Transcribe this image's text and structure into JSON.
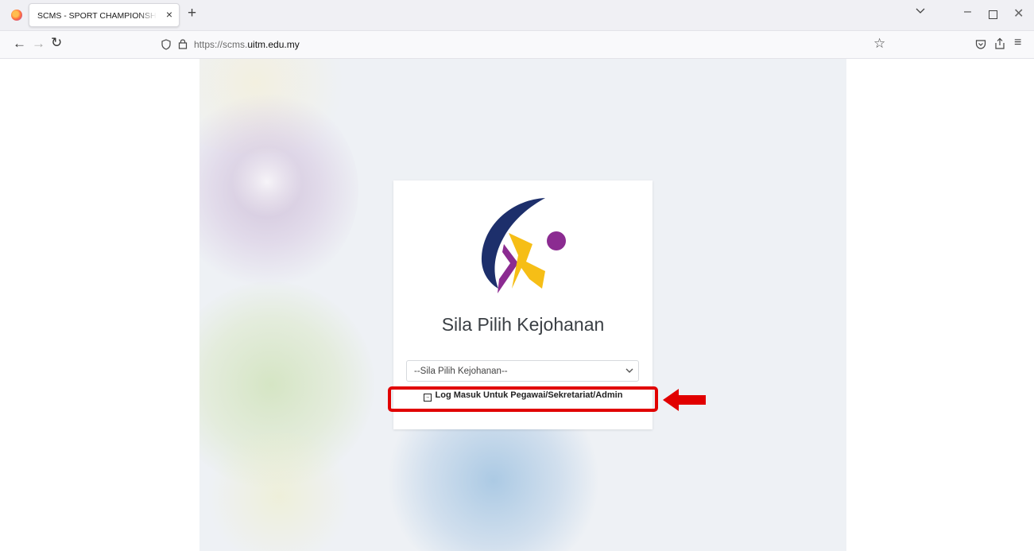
{
  "browser": {
    "tab_title": "SCMS - SPORT CHAMPIONSHIP MANAGEMENT SYSTEM",
    "tab_close": "×",
    "new_tab": "+",
    "url_prefix": "https://scms.",
    "url_domain": "uitm.edu.my",
    "icons": [
      "firefox-icon",
      "back-icon",
      "forward-icon",
      "reload-icon",
      "shield-icon",
      "lock-icon",
      "star-icon",
      "pocket-icon",
      "share-icon",
      "menu-icon"
    ]
  },
  "page": {
    "heading": "Sila Pilih Kejohanan",
    "select_value": "--Sila Pilih Kejohanan--",
    "login_link": "Log Masuk Untuk Pegawai/Sekretariat/Admin",
    "logo_colors": {
      "arc": "#1d2f6b",
      "purple": "#8b2b91",
      "yellow": "#f6be16"
    },
    "annotation_color": "#e10000"
  }
}
